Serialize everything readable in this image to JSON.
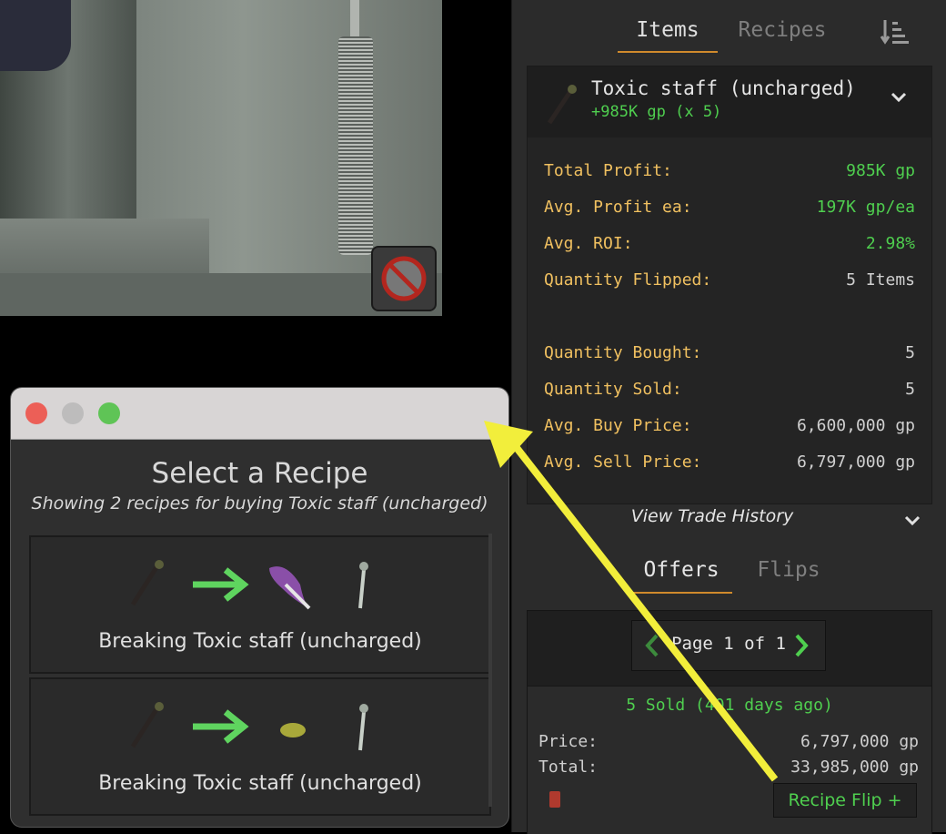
{
  "panel": {
    "tabs": [
      {
        "label": "Items"
      },
      {
        "label": "Recipes"
      }
    ],
    "item": {
      "name": "Toxic staff (uncharged)",
      "profit_summary": "+985K gp (x 5)"
    },
    "stats": [
      {
        "label": "Total Profit:",
        "value": "985K gp"
      },
      {
        "label": "Avg. Profit ea:",
        "value": "197K gp/ea"
      },
      {
        "label": "Avg. ROI:",
        "value": "2.98%"
      },
      {
        "label": "Quantity Flipped:",
        "value": "5 Items"
      },
      {
        "label": "Quantity Bought:",
        "value": "5"
      },
      {
        "label": "Quantity Sold:",
        "value": "5"
      },
      {
        "label": "Avg. Buy Price:",
        "value": "6,600,000 gp"
      },
      {
        "label": "Avg. Sell Price:",
        "value": "6,797,000 gp"
      }
    ],
    "view_history": "View Trade History",
    "history_tabs": [
      {
        "label": "Offers"
      },
      {
        "label": "Flips"
      }
    ],
    "pager": "Page 1 of 1",
    "offer": {
      "status": "5 Sold (401 days ago)",
      "price_label": "Price:",
      "price_value": "6,797,000 gp",
      "total_label": "Total:",
      "total_value": "33,985,000 gp",
      "button": "Recipe Flip +"
    }
  },
  "dialog": {
    "title": "Select a Recipe",
    "subtitle": "Showing 2 recipes for buying Toxic staff (uncharged)",
    "recipes": [
      {
        "label": "Breaking Toxic staff (uncharged)"
      },
      {
        "label": "Breaking Toxic staff (uncharged)"
      }
    ]
  },
  "colors": {
    "profit_green": "#4fcf4f",
    "label_gold": "#f0c060",
    "accent_orange": "#d08a2c",
    "annotation_yellow": "#f2ee3b"
  }
}
